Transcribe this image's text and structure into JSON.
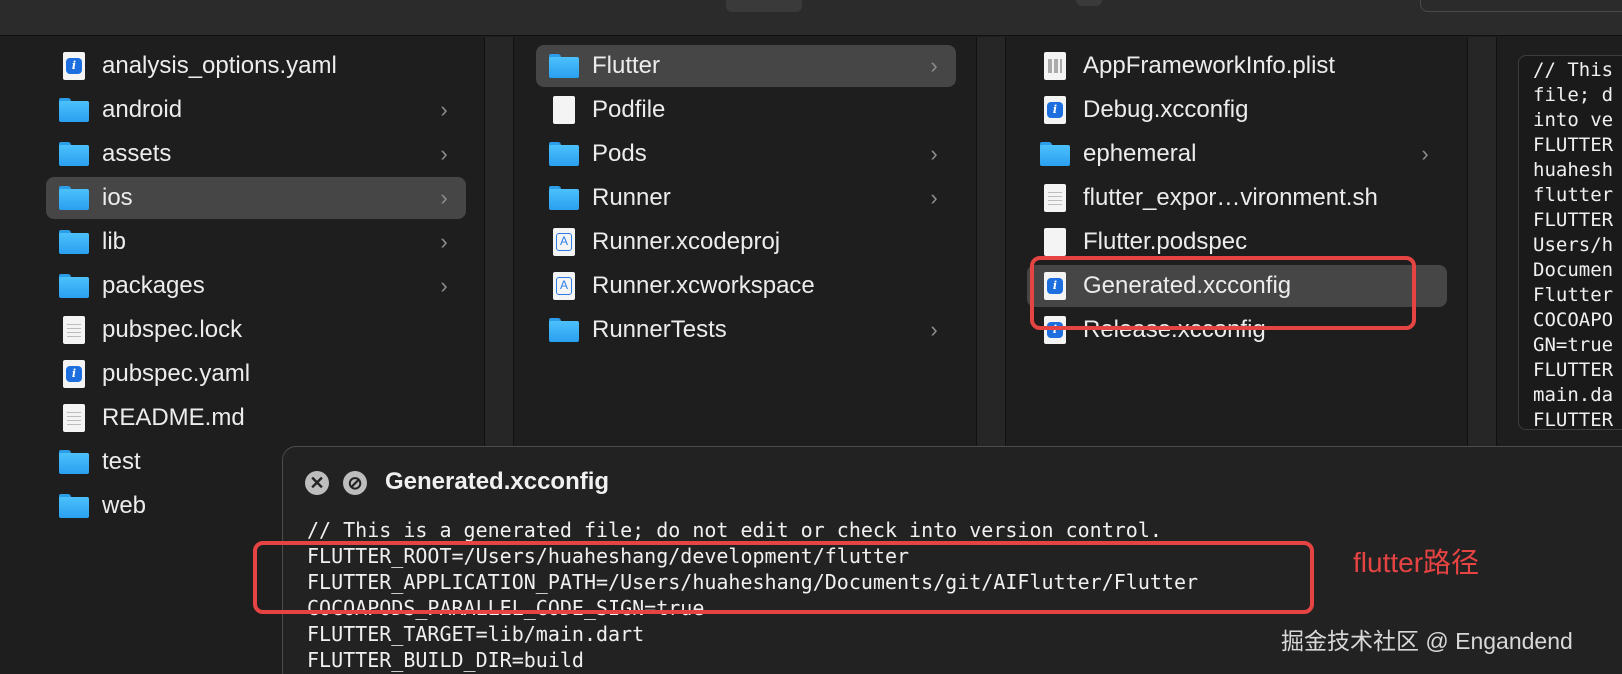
{
  "columns": {
    "col1": [
      {
        "label": "analysis_options.yaml",
        "icon": "dart-file-icon",
        "chevron": false
      },
      {
        "label": "android",
        "icon": "folder-icon",
        "chevron": true
      },
      {
        "label": "assets",
        "icon": "folder-icon",
        "chevron": true
      },
      {
        "label": "ios",
        "icon": "folder-icon",
        "chevron": true,
        "selected": true
      },
      {
        "label": "lib",
        "icon": "folder-icon",
        "chevron": true
      },
      {
        "label": "packages",
        "icon": "folder-icon",
        "chevron": true
      },
      {
        "label": "pubspec.lock",
        "icon": "text-file-icon",
        "chevron": false
      },
      {
        "label": "pubspec.yaml",
        "icon": "dart-file-icon",
        "chevron": false
      },
      {
        "label": "README.md",
        "icon": "text-file-icon",
        "chevron": false
      },
      {
        "label": "test",
        "icon": "folder-icon",
        "chevron": false
      },
      {
        "label": "web",
        "icon": "folder-icon",
        "chevron": false
      }
    ],
    "col2": [
      {
        "label": "Flutter",
        "icon": "folder-icon",
        "chevron": true,
        "selected": true
      },
      {
        "label": "Podfile",
        "icon": "blank-file-icon",
        "chevron": false
      },
      {
        "label": "Pods",
        "icon": "folder-icon",
        "chevron": true
      },
      {
        "label": "Runner",
        "icon": "folder-icon",
        "chevron": true
      },
      {
        "label": "Runner.xcodeproj",
        "icon": "xcode-project-icon",
        "chevron": false
      },
      {
        "label": "Runner.xcworkspace",
        "icon": "xcode-project-icon",
        "chevron": false
      },
      {
        "label": "RunnerTests",
        "icon": "folder-icon",
        "chevron": true
      }
    ],
    "col3": [
      {
        "label": "AppFrameworkInfo.plist",
        "icon": "plist-file-icon",
        "chevron": false
      },
      {
        "label": "Debug.xcconfig",
        "icon": "dart-file-icon",
        "chevron": false
      },
      {
        "label": "ephemeral",
        "icon": "folder-icon",
        "chevron": true
      },
      {
        "label": "flutter_expor…vironment.sh",
        "icon": "text-file-icon",
        "chevron": false
      },
      {
        "label": "Flutter.podspec",
        "icon": "blank-file-icon",
        "chevron": false
      },
      {
        "label": "Generated.xcconfig",
        "icon": "dart-file-icon",
        "chevron": false,
        "selected": true
      },
      {
        "label": "Release.xcconfig",
        "icon": "dart-file-icon",
        "chevron": false
      }
    ]
  },
  "preview": {
    "text": "// This\nfile; d\ninto ve\nFLUTTER\nhuahesh\nflutter\nFLUTTER\nUsers/h\nDocumen\nFlutter\nCOCOAPO\nGN=true\nFLUTTER\nmain.da\nFLUTTER"
  },
  "quicklook": {
    "close_glyph": "✕",
    "disable_glyph": "⊘",
    "title": "Generated.xcconfig",
    "content": "// This is a generated file; do not edit or check into version control.\nFLUTTER_ROOT=/Users/huaheshang/development/flutter\nFLUTTER_APPLICATION_PATH=/Users/huaheshang/Documents/git/AIFlutter/Flutter\nCOCOAPODS_PARALLEL_CODE_SIGN=true\nFLUTTER_TARGET=lib/main.dart\nFLUTTER_BUILD_DIR=build"
  },
  "annotation": "flutter路径",
  "watermark": "掘金技术社区 @ Engandend",
  "colors": {
    "highlight": "#e64343",
    "folder": "#2a9ff0",
    "selection": "#464646"
  }
}
